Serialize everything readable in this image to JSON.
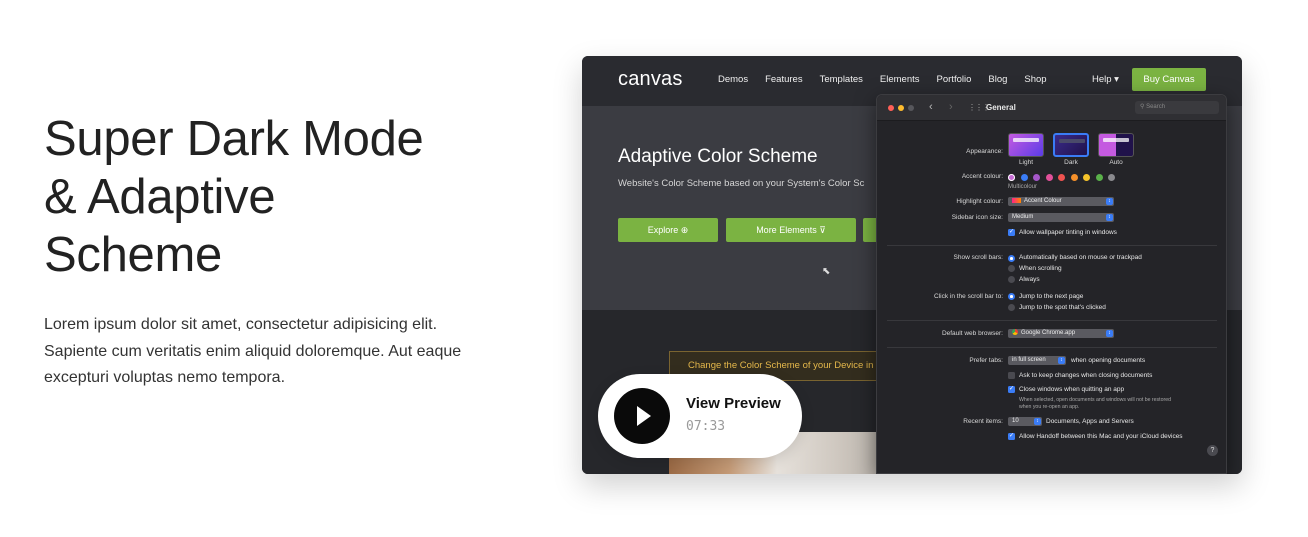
{
  "hero": {
    "title_line1": "Super Dark Mode",
    "title_line2": "& Adaptive",
    "title_line3": "Scheme",
    "description": "Lorem ipsum dolor sit amet, consectetur adipisicing elit. Sapiente cum veritatis enim aliquid doloremque. Aut eaque excepturi voluptas nemo tempora."
  },
  "site": {
    "logo": "canvas",
    "nav": [
      "Demos",
      "Features",
      "Templates",
      "Elements",
      "Portfolio",
      "Blog",
      "Shop"
    ],
    "help": "Help ▾",
    "buy_label": "Buy Canvas",
    "section_title": "Adaptive Color Scheme",
    "section_subtitle": "Website's Color Scheme based on your System's Color Sc",
    "explore_label": "Explore ⊕",
    "more_elements_label": "More Elements ⊽",
    "notice": "Change the Color Scheme of your Device in Sys",
    "accent_color": "#7bb342"
  },
  "prefs": {
    "title": "General",
    "search_placeholder": "Search",
    "appearance_label": "Appearance:",
    "appearance_options": [
      "Light",
      "Dark",
      "Auto"
    ],
    "accent_label": "Accent colour:",
    "accent_caption": "Multicolour",
    "accent_colors": [
      "#c86cd6",
      "#3a7cf6",
      "#a557c9",
      "#e2509a",
      "#ef5350",
      "#f5902a",
      "#f5c32a",
      "#5ab14a",
      "#8a8a8e"
    ],
    "highlight_label": "Highlight colour:",
    "highlight_value": "Accent Colour",
    "sidebar_label": "Sidebar icon size:",
    "sidebar_value": "Medium",
    "wallpaper_tinting": "Allow wallpaper tinting in windows",
    "scroll_bars_label": "Show scroll bars:",
    "scroll_options": [
      "Automatically based on mouse or trackpad",
      "When scrolling",
      "Always"
    ],
    "click_scroll_label": "Click in the scroll bar to:",
    "click_options": [
      "Jump to the next page",
      "Jump to the spot that's clicked"
    ],
    "browser_label": "Default web browser:",
    "browser_value": "Google Chrome.app",
    "prefer_tabs_label": "Prefer tabs:",
    "prefer_tabs_value": "in full screen",
    "prefer_tabs_suffix": "when opening documents",
    "ask_keep": "Ask to keep changes when closing documents",
    "close_windows": "Close windows when quitting an app",
    "close_windows_note_1": "When selected, open documents and windows will not be restored",
    "close_windows_note_2": "when you re-open an app.",
    "recent_label": "Recent items:",
    "recent_value": "10",
    "recent_suffix": "Documents, Apps and Servers",
    "handoff": "Allow Handoff between this Mac and your iCloud devices",
    "help_icon": "?"
  },
  "preview": {
    "label": "View Preview",
    "duration": "07:33"
  }
}
